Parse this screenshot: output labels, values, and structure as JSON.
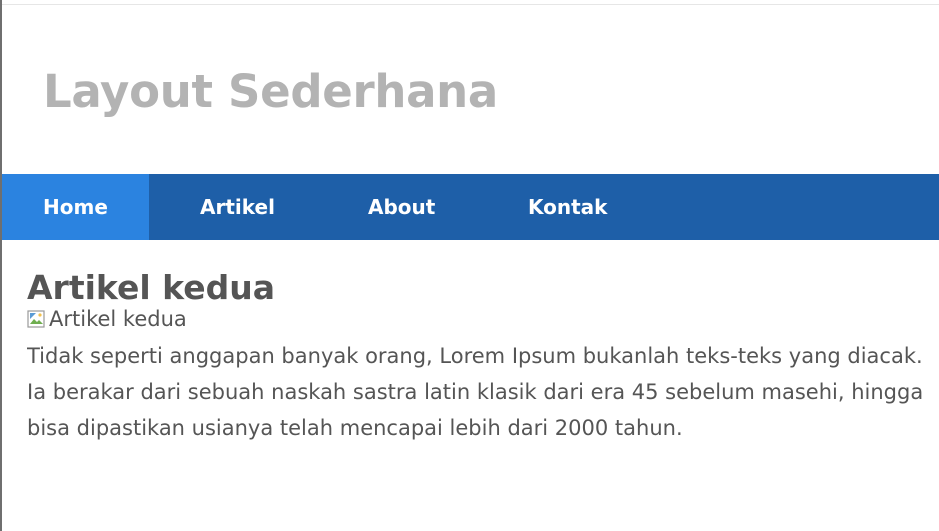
{
  "header": {
    "site_title": "Layout Sederhana"
  },
  "nav": {
    "items": [
      {
        "label": "Home",
        "active": true
      },
      {
        "label": "Artikel",
        "active": false
      },
      {
        "label": "About",
        "active": false
      },
      {
        "label": "Kontak",
        "active": false
      }
    ]
  },
  "article": {
    "title": "Artikel kedua",
    "image_alt": "Artikel kedua",
    "image_icon": "broken-image-icon",
    "lines": [
      "Tidak seperti anggapan banyak orang, Lorem Ipsum bukanlah teks-teks yang diacak.",
      "Ia berakar dari sebuah naskah sastra latin klasik dari era 45 sebelum masehi, hingga",
      "bisa dipastikan usianya telah mencapai lebih dari 2000 tahun."
    ]
  },
  "colors": {
    "nav_background": "#1e5fa8",
    "nav_active": "#2b83e0",
    "site_title": "#b3b3b3",
    "body_text": "#555555"
  }
}
